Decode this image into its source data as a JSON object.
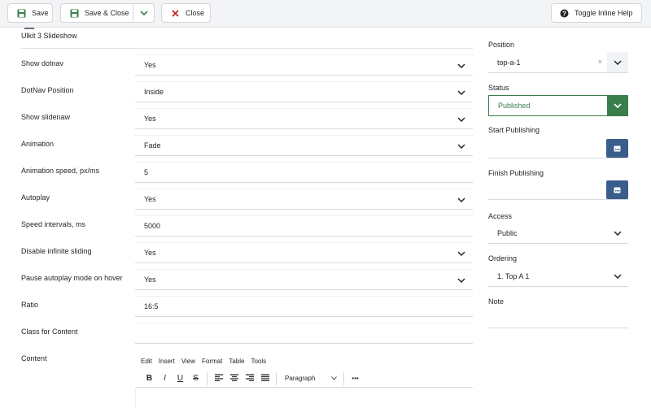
{
  "toolbar": {
    "save_label": "Save",
    "save_close_label": "Save & Close",
    "close_label": "Close",
    "help_label": "Toggle Inline Help"
  },
  "form": {
    "legend": "Ulkit 3 Slideshow",
    "fields": [
      {
        "label": "Show dotnav",
        "value": "Yes"
      },
      {
        "label": "DotNav Position",
        "value": "Inside"
      },
      {
        "label": "Show slidenaw",
        "value": "Yes"
      },
      {
        "label": "Animation",
        "value": "Fade"
      },
      {
        "label": "Animation speed, px/ms",
        "value": "5"
      },
      {
        "label": "Autoplay",
        "value": "Yes"
      },
      {
        "label": "Speed intervals, ms",
        "value": "5000"
      },
      {
        "label": "Disable infinite sliding",
        "value": "Yes"
      },
      {
        "label": "Pause autoplay mode on hover",
        "value": "Yes"
      },
      {
        "label": "Ratio",
        "value": "16:5"
      },
      {
        "label": "Class for Content",
        "value": ""
      },
      {
        "label": "Content"
      }
    ]
  },
  "editor": {
    "menu": [
      "Edit",
      "Insert",
      "View",
      "Format",
      "Table",
      "Tools"
    ],
    "paragraph": "Paragraph",
    "tools": {
      "bold": "B",
      "italic": "I",
      "underline": "U",
      "strike": "S",
      "more": "•••"
    }
  },
  "sidebar": {
    "position_label": "Position",
    "position_value": "top-a-1",
    "position_clear": "×",
    "status_label": "Status",
    "status_value": "Published",
    "start_label": "Start Publishing",
    "finish_label": "Finish Publishing",
    "access_label": "Access",
    "access_value": "Public",
    "ordering_label": "Ordering",
    "ordering_value": "1. Top A 1",
    "note_label": "Note"
  },
  "colors": {
    "published_green": "#3a7f4b",
    "calendar_blue": "#3a5e8c",
    "close_red": "#c52827",
    "save_green": "#3a7f4b"
  },
  "icons": [
    "save-icon",
    "chevron-down-icon",
    "close-icon",
    "help-icon",
    "calendar-icon",
    "align-left-icon",
    "align-center-icon",
    "align-right-icon",
    "justify-icon"
  ]
}
